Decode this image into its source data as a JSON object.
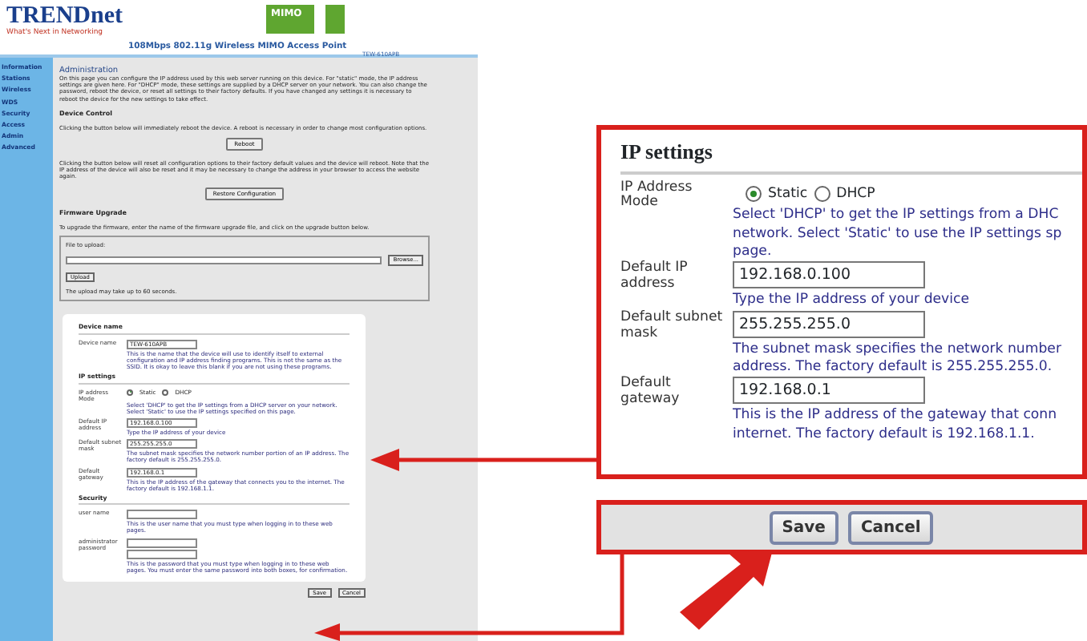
{
  "left_screenshot": {
    "header": {
      "logo": "TRENDnet",
      "tagline": "What's Next in Networking",
      "mimo_badge": "MIMO",
      "product_title": "108Mbps 802.11g Wireless MIMO Access Point",
      "model": "TEW-610APB"
    },
    "sidebar": {
      "items": [
        "Information",
        "Stations",
        "Wireless",
        "WDS",
        "Security",
        "Access",
        "Admin",
        "Advanced"
      ]
    },
    "content": [
      {
        "kind": "heading",
        "text": "Administration"
      },
      {
        "kind": "para",
        "text": "On this page you can configure the IP address used by this web server running on this device. For \"static\" mode, the IP address settings are given here. For \"DHCP\" mode, these settings are supplied by a DHCP server on your network. You can also change the password, reboot the device, or reset all settings to their factory defaults. If you have changed any settings it is necessary to reboot the device for the new settings to take effect."
      },
      {
        "kind": "subheading",
        "text": "Device Control"
      },
      {
        "kind": "para",
        "text": "Clicking the button below will immediately reboot the device. A reboot is necessary in order to change most configuration options."
      },
      {
        "kind": "button",
        "text": "Reboot"
      },
      {
        "kind": "para",
        "text": "Clicking the button below will reset all configuration options to their factory default values and the device will reboot. Note that the IP address of the device will also be reset and it may be necessary to change the address in your browser to access the website again."
      },
      {
        "kind": "button",
        "text": "Restore Configuration"
      },
      {
        "kind": "subheading",
        "text": "Firmware Upgrade"
      },
      {
        "kind": "para",
        "text": "To upgrade the firmware, enter the name of the firmware upgrade file, and click on the upgrade button below."
      },
      {
        "kind": "upload",
        "label": "File to upload:",
        "browse": "Browse...",
        "upload": "Upload",
        "note": "The upload may take up to 60 seconds."
      }
    ],
    "panel": [
      {
        "title": "Device name",
        "rows": [
          {
            "kind": "input",
            "label": "Device name",
            "value": "TEW-610APB",
            "hint": "This is the name that the device will use to identify itself to external configuration and IP address finding programs. This is not the same as the SSID. It is okay to leave this blank if you are not using these programs."
          }
        ]
      },
      {
        "title": "IP settings",
        "rows": [
          {
            "kind": "radio",
            "label": "IP address Mode",
            "options": [
              {
                "label": "Static",
                "selected": true
              },
              {
                "label": "DHCP",
                "selected": false
              }
            ],
            "hint": "Select 'DHCP' to get the IP settings from a DHCP server on your network. Select 'Static' to use the IP settings specified on this page."
          },
          {
            "kind": "input",
            "label": "Default IP address",
            "value": "192.168.0.100",
            "hint": "Type the IP address of your device"
          },
          {
            "kind": "input",
            "label": "Default subnet mask",
            "value": "255.255.255.0",
            "hint": "The subnet mask specifies the network number portion of an IP address. The factory default is 255.255.255.0."
          },
          {
            "kind": "input",
            "label": "Default gateway",
            "value": "192.168.0.1",
            "hint": "This is the IP address of the gateway that connects you to the internet. The factory default is 192.168.1.1."
          }
        ]
      },
      {
        "title": "Security",
        "rows": [
          {
            "kind": "input",
            "label": "user name",
            "hint": "This is the user name that you must type when logging in to these web pages."
          },
          {
            "kind": "double-input",
            "label": "administrator password",
            "hint": "This is the password that you must type when logging in to these web pages. You must enter the same password into both boxes, for confirmation."
          }
        ]
      }
    ],
    "buttons": [
      "Save",
      "Cancel"
    ]
  },
  "ip_settings_callout": {
    "title": "IP settings",
    "rows": [
      {
        "kind": "radio",
        "label": "IP Address Mode",
        "options": [
          {
            "label": "Static",
            "selected": true
          },
          {
            "label": "DHCP",
            "selected": false
          }
        ],
        "hint_lines": [
          "Select 'DHCP' to get the IP settings from a DHC",
          "network. Select 'Static' to use the IP settings sp",
          "page."
        ]
      },
      {
        "kind": "input",
        "label": "Default IP address",
        "value": "192.168.0.100",
        "hint_lines": [
          "Type the IP address of your device"
        ]
      },
      {
        "kind": "input",
        "label": "Default subnet mask",
        "value": "255.255.255.0",
        "hint_lines": [
          "The subnet mask specifies the network number",
          "address. The factory default is 255.255.255.0."
        ]
      },
      {
        "kind": "input",
        "label": "Default gateway",
        "value": "192.168.0.1",
        "hint_lines": [
          "This is the IP address of the gateway that conn",
          "internet. The factory default is 192.168.1.1."
        ]
      }
    ]
  },
  "buttons_callout": {
    "buttons": [
      "Save",
      "Cancel"
    ]
  }
}
